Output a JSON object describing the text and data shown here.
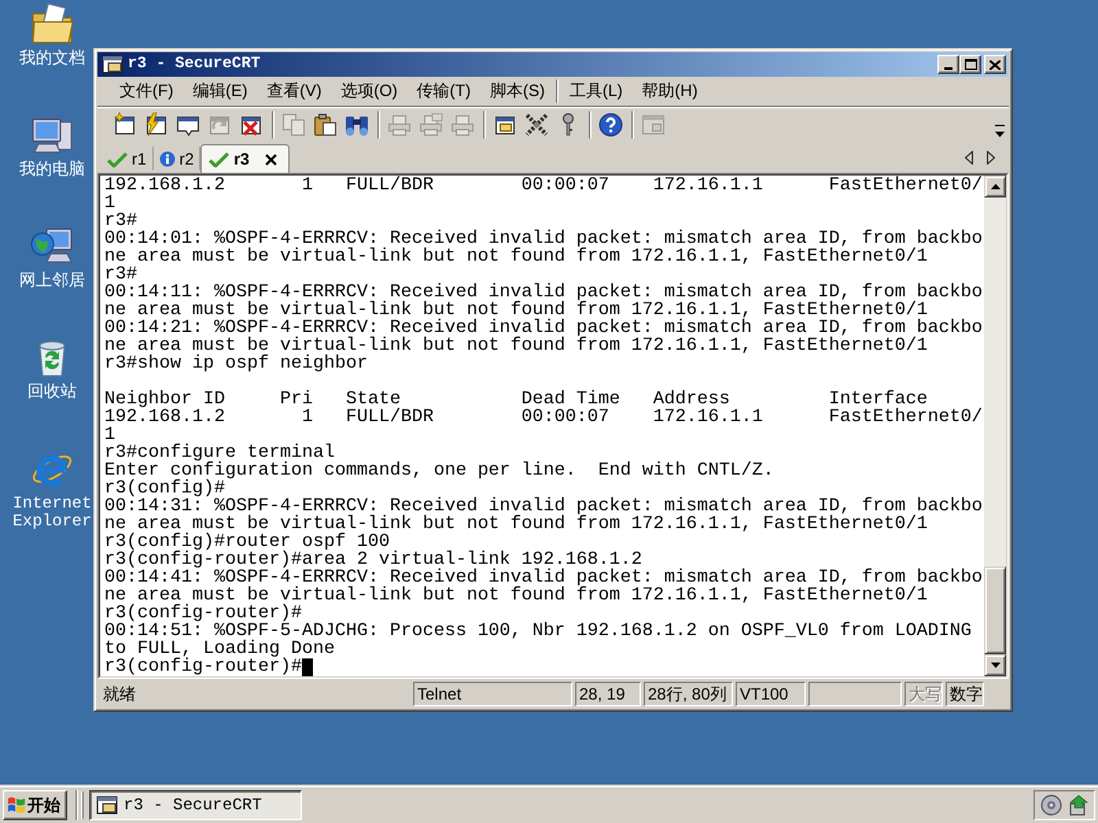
{
  "desktop_icons": [
    {
      "label": "我的文档"
    },
    {
      "label": "我的电脑"
    },
    {
      "label": "网上邻居"
    },
    {
      "label": "回收站"
    },
    {
      "label": "Internet Explorer"
    }
  ],
  "window": {
    "title": "r3 - SecureCRT",
    "menu": [
      [
        "文件(F)",
        "编辑(E)",
        "查看(V)",
        "选项(O)",
        "传输(T)",
        "脚本(S)"
      ],
      [
        "工具(L)",
        "帮助(H)"
      ]
    ],
    "toolbar": [
      [
        {
          "disabled": false
        },
        {
          "disabled": false
        },
        {
          "disabled": false
        },
        {
          "disabled": true
        },
        {
          "disabled": false
        }
      ],
      [
        {
          "disabled": true
        },
        {
          "disabled": false
        },
        {
          "disabled": false
        }
      ],
      [
        {
          "disabled": true
        },
        {
          "disabled": true
        },
        {
          "disabled": true
        }
      ],
      [
        {
          "disabled": false
        },
        {
          "disabled": false
        },
        {
          "disabled": false
        }
      ],
      [
        {
          "disabled": false
        }
      ],
      [
        {
          "disabled": true
        }
      ]
    ],
    "tabs": [
      {
        "label": "r1",
        "kind": "check",
        "selected": false
      },
      {
        "label": "r2",
        "kind": "info",
        "selected": false
      },
      {
        "label": "r3",
        "kind": "check",
        "selected": true
      }
    ],
    "terminal": {
      "blocks": [
        [
          "192.168.1.2       1   FULL/BDR        00:00:07    172.16.1.1      FastEthernet0/",
          "1",
          "r3#",
          "00:14:01: %OSPF-4-ERRRCV: Received invalid packet: mismatch area ID, from backbo",
          "ne area must be virtual-link but not found from 172.16.1.1, FastEthernet0/1",
          "r3#",
          "00:14:11: %OSPF-4-ERRRCV: Received invalid packet: mismatch area ID, from backbo",
          "ne area must be virtual-link but not found from 172.16.1.1, FastEthernet0/1",
          "00:14:21: %OSPF-4-ERRRCV: Received invalid packet: mismatch area ID, from backbo",
          "ne area must be virtual-link but not found from 172.16.1.1, FastEthernet0/1",
          "r3#show ip ospf neighbor"
        ],
        [
          "Neighbor ID     Pri   State           Dead Time   Address         Interface",
          "192.168.1.2       1   FULL/BDR        00:00:07    172.16.1.1      FastEthernet0/",
          "1",
          "r3#configure terminal",
          "Enter configuration commands, one per line.  End with CNTL/Z.",
          "r3(config)#",
          "00:14:31: %OSPF-4-ERRRCV: Received invalid packet: mismatch area ID, from backbo",
          "ne area must be virtual-link but not found from 172.16.1.1, FastEthernet0/1",
          "r3(config)#router ospf 100",
          "r3(config-router)#area 2 virtual-link 192.168.1.2",
          "00:14:41: %OSPF-4-ERRRCV: Received invalid packet: mismatch area ID, from backbo",
          "ne area must be virtual-link but not found from 172.16.1.1, FastEthernet0/1",
          "r3(config-router)#",
          "00:14:51: %OSPF-5-ADJCHG: Process 100, Nbr 192.168.1.2 on OSPF_VL0 from LOADING",
          "to FULL, Loading Done",
          "r3(config-router)#"
        ]
      ]
    },
    "status_bar": {
      "message": "就绪",
      "panels": [
        "Telnet",
        "28, 19",
        "28行, 80列",
        "VT100"
      ],
      "indicators": [
        {
          "label": "大写",
          "on": false
        },
        {
          "label": "数字",
          "on": true
        }
      ]
    }
  },
  "taskbar": {
    "start": "开始",
    "tasks": [
      {
        "label": "r3 - SecureCRT",
        "selected": true
      }
    ]
  }
}
